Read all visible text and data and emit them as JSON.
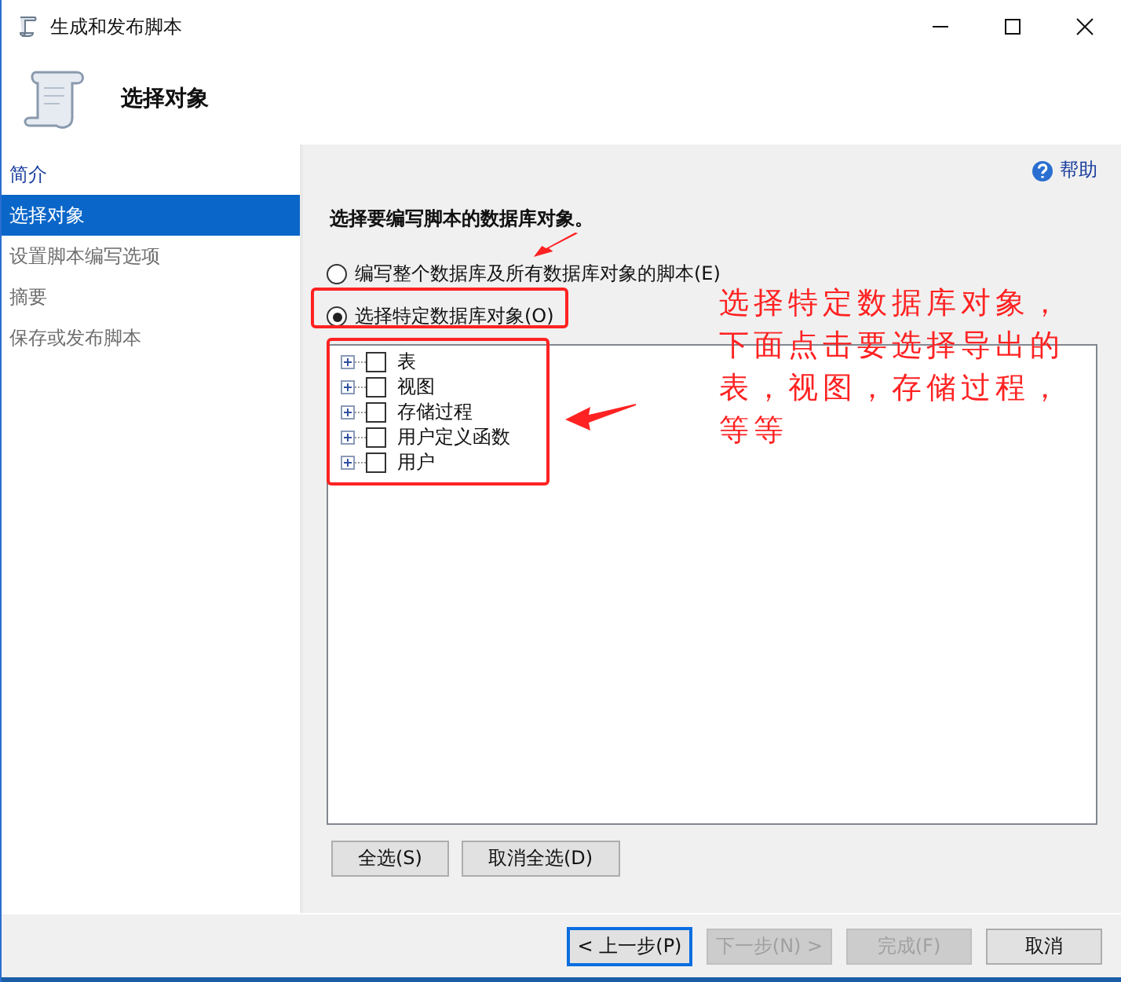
{
  "window": {
    "title": "生成和发布脚本"
  },
  "header": {
    "title": "选择对象"
  },
  "sidebar": {
    "items": [
      {
        "label": "简介",
        "selected": false,
        "kind": "link"
      },
      {
        "label": "选择对象",
        "selected": true,
        "kind": "step"
      },
      {
        "label": "设置脚本编写选项",
        "selected": false,
        "kind": "step"
      },
      {
        "label": "摘要",
        "selected": false,
        "kind": "step"
      },
      {
        "label": "保存或发布脚本",
        "selected": false,
        "kind": "step"
      }
    ]
  },
  "help": "帮助",
  "heading": "选择要编写脚本的数据库对象。",
  "options": [
    {
      "label": "编写整个数据库及所有数据库对象的脚本(E)",
      "selected": false
    },
    {
      "label": "选择特定数据库对象(O)",
      "selected": true
    }
  ],
  "tree": [
    {
      "label": "表",
      "checked": false,
      "expanded": false
    },
    {
      "label": "视图",
      "checked": false,
      "expanded": false
    },
    {
      "label": "存储过程",
      "checked": false,
      "expanded": false
    },
    {
      "label": "用户定义函数",
      "checked": false,
      "expanded": false
    },
    {
      "label": "用户",
      "checked": false,
      "expanded": false
    }
  ],
  "tree_buttons": [
    "全选(S)",
    "取消全选(D)"
  ],
  "footer_buttons": [
    {
      "label": "< 上一步(P)",
      "disabled": false
    },
    {
      "label": "下一步(N) >",
      "disabled": true
    },
    {
      "label": "完成(F)",
      "disabled": true
    },
    {
      "label": "取消",
      "disabled": false
    }
  ],
  "annotation": {
    "text": "选择特定数据库对象，下面点击要选择导出的表，视图，存储过程，等等"
  }
}
